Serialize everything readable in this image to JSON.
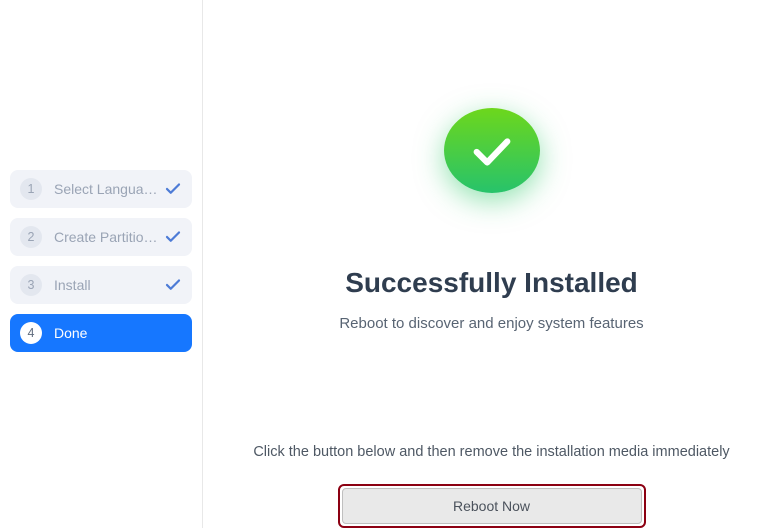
{
  "sidebar": {
    "steps": [
      {
        "num": "1",
        "label": "Select Language",
        "state": "done"
      },
      {
        "num": "2",
        "label": "Create Partitions",
        "state": "done"
      },
      {
        "num": "3",
        "label": "Install",
        "state": "done"
      },
      {
        "num": "4",
        "label": "Done",
        "state": "active"
      }
    ]
  },
  "main": {
    "title": "Successfully Installed",
    "subtitle": "Reboot to discover and enjoy system features",
    "hint": "Click the button below and then remove the installation media immediately",
    "reboot_label": "Reboot Now"
  },
  "icons": {
    "check": "check-icon",
    "success": "success-check-icon"
  }
}
